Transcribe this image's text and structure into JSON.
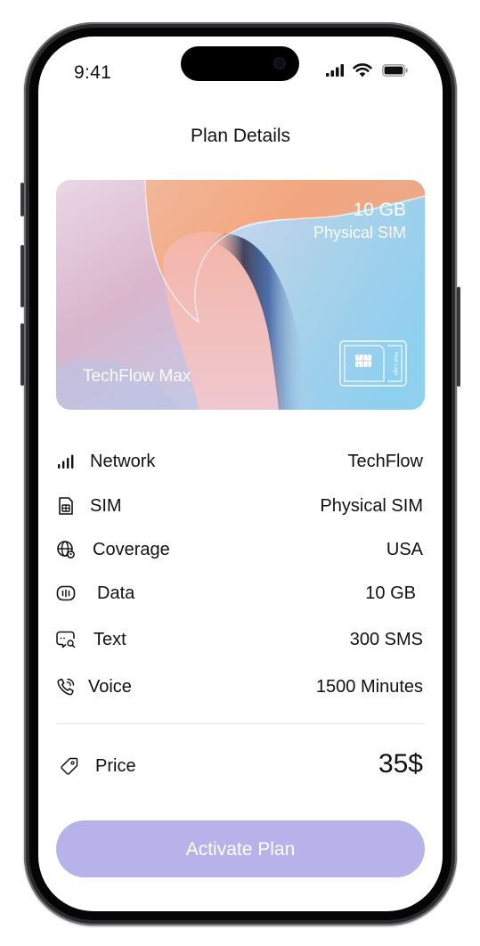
{
  "status_bar": {
    "time": "9:41"
  },
  "header": {
    "title": "Plan Details"
  },
  "card": {
    "data_amount": "10 GB",
    "sim_type": "Physical SIM",
    "plan_name": "TechFlow Max",
    "logo_placeholder": "Your Logo"
  },
  "details": {
    "network": {
      "label": "Network",
      "value": "TechFlow",
      "icon": "signal-bars-icon"
    },
    "sim": {
      "label": "SIM",
      "value": "Physical SIM",
      "icon": "sim-card-icon"
    },
    "coverage": {
      "label": "Coverage",
      "value": "USA",
      "icon": "globe-icon"
    },
    "data": {
      "label": "Data",
      "value": "10 GB",
      "icon": "data-meter-icon"
    },
    "text": {
      "label": "Text",
      "value": "300 SMS",
      "icon": "message-search-icon"
    },
    "voice": {
      "label": "Voice",
      "value": "1500 Minutes",
      "icon": "phone-call-icon"
    }
  },
  "price": {
    "label": "Price",
    "value": "35$",
    "icon": "price-tag-icon"
  },
  "cta": {
    "label": "Activate Plan"
  },
  "colors": {
    "accent": "#b7b2ea",
    "text": "#111111",
    "divider": "#e2e2e2"
  }
}
